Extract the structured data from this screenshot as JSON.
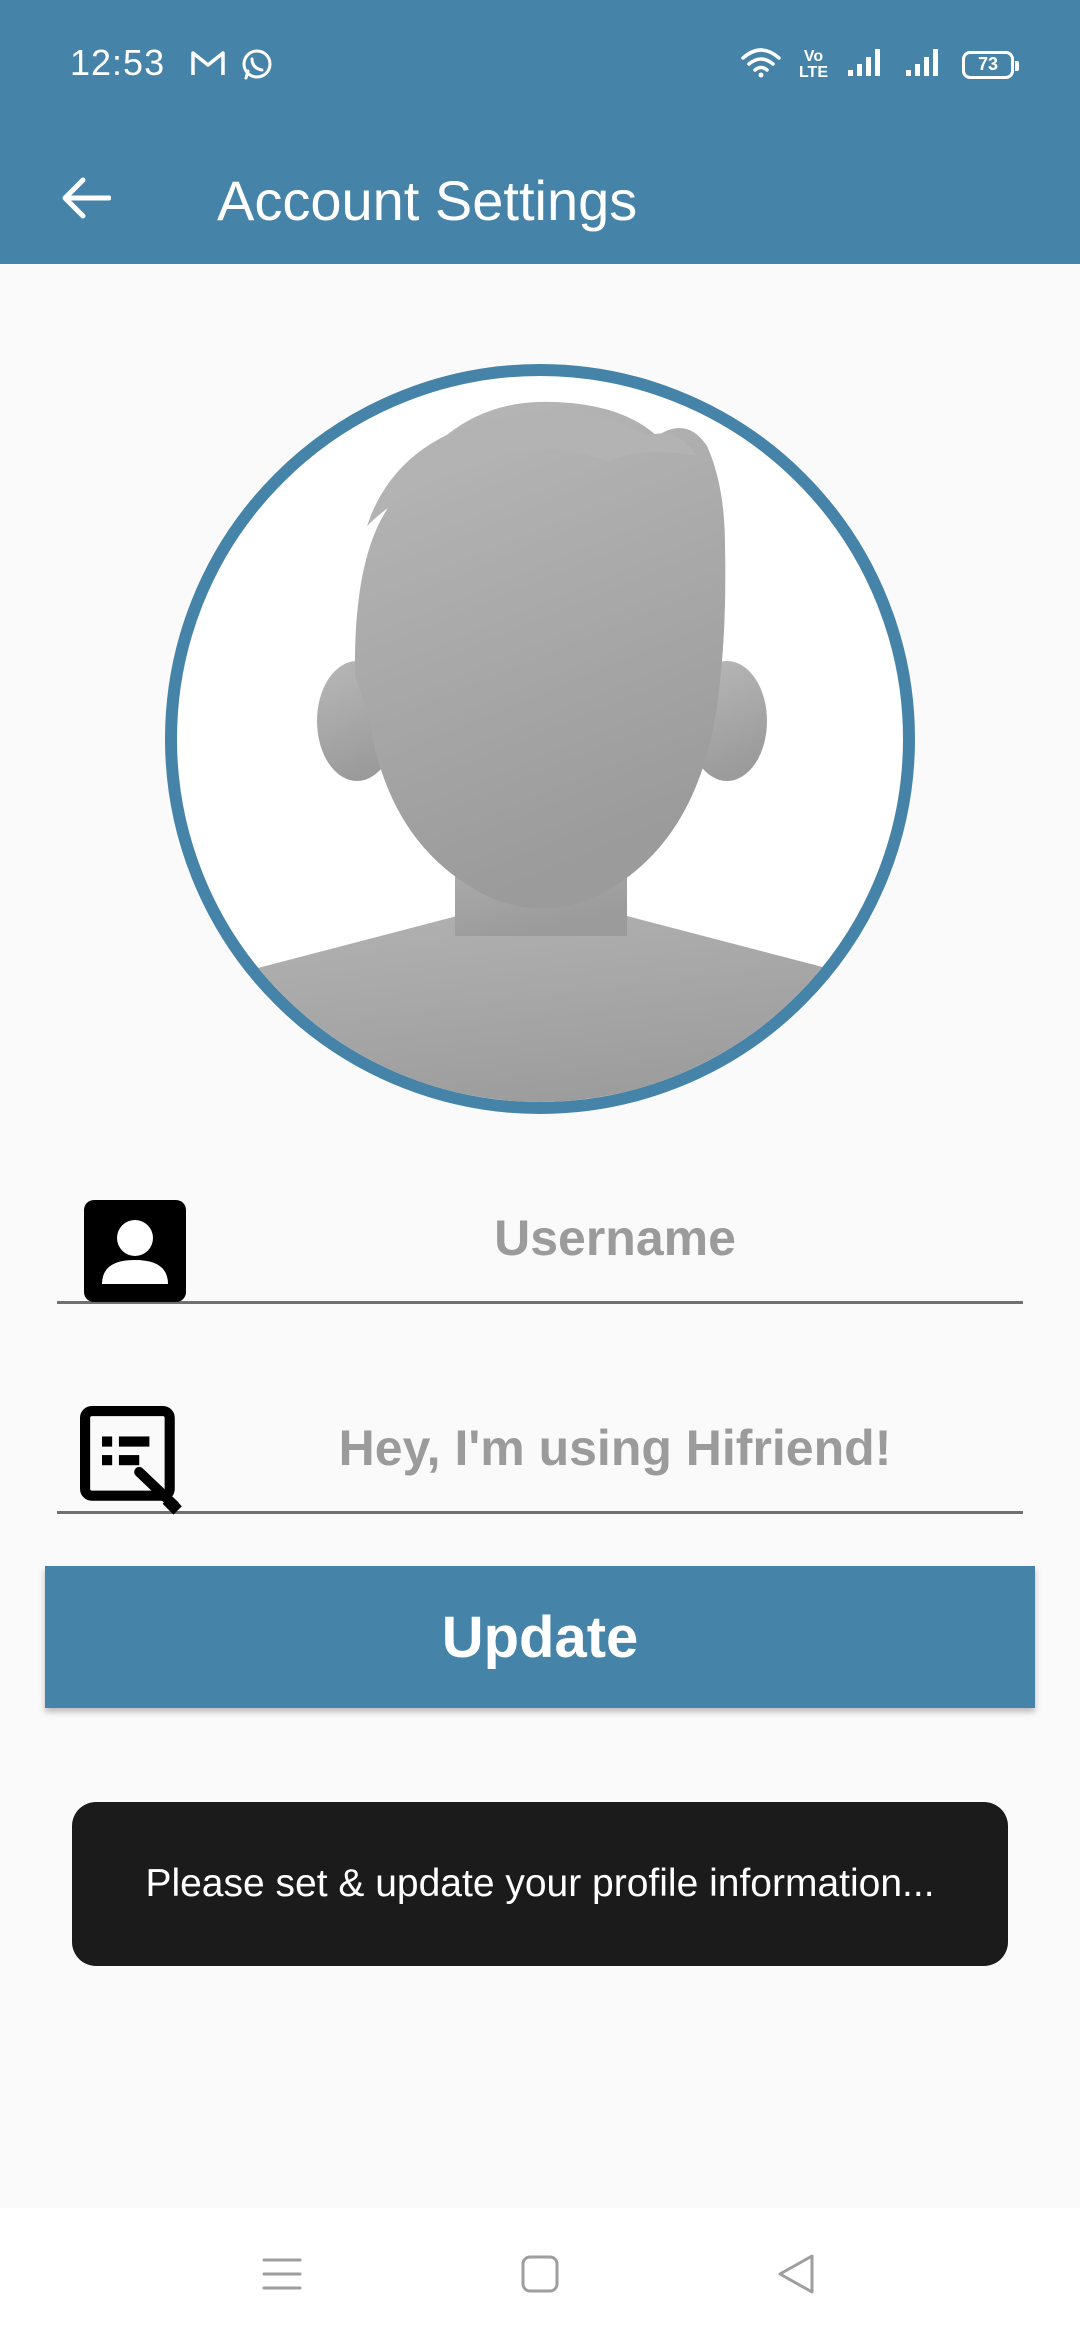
{
  "status_bar": {
    "time": "12:53",
    "battery": "73",
    "volte": "Vo\nLTE",
    "icons": [
      "gmail-icon",
      "whatsapp-icon",
      "wifi-icon",
      "volte-icon",
      "signal-icon",
      "signal-icon",
      "battery-icon"
    ]
  },
  "toolbar": {
    "title": "Account Settings",
    "back_icon": "arrow-left-icon"
  },
  "profile": {
    "avatar_icon": "default-avatar-icon"
  },
  "form": {
    "username": {
      "value": "",
      "placeholder": "Username",
      "icon": "account-box-icon"
    },
    "status": {
      "value": "",
      "placeholder": "Hey, I'm using Hifriend!",
      "icon": "edit-note-icon"
    },
    "update_label": "Update"
  },
  "toast": {
    "message": "Please set & update your profile information..."
  },
  "nav_bar": {
    "icons": [
      "menu-icon",
      "home-square-icon",
      "back-triangle-icon"
    ]
  },
  "colors": {
    "primary": "#4584a8",
    "background": "#fafafa",
    "toast_bg": "#1b1b1b",
    "placeholder": "#9b9b9b"
  }
}
